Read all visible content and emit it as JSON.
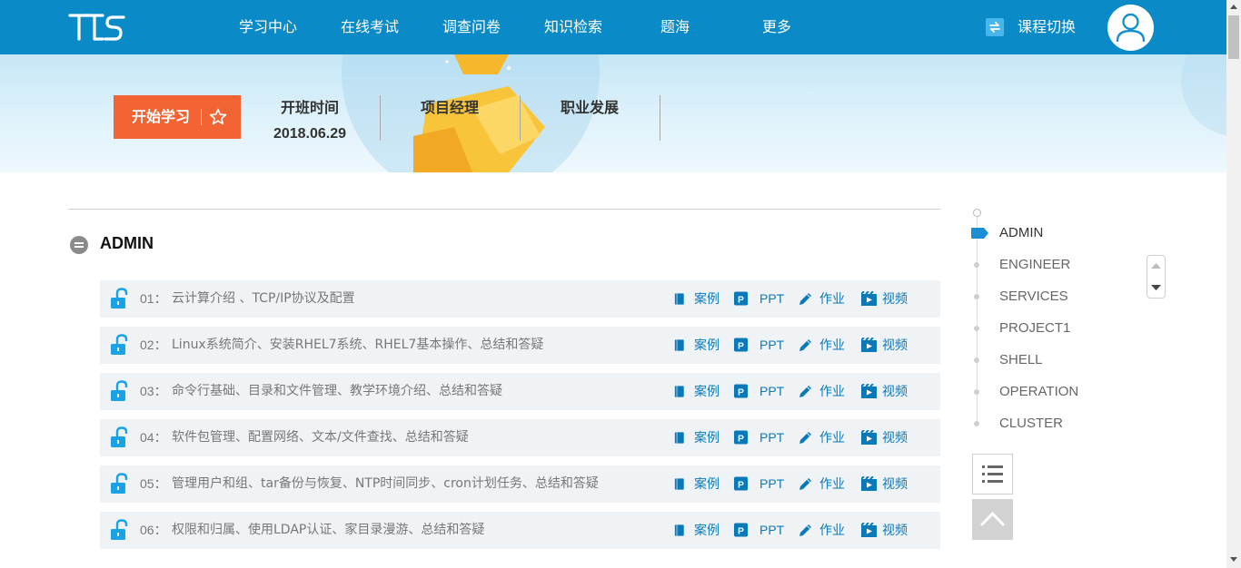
{
  "header": {
    "logo_text": "TTS",
    "nav": [
      "学习中心",
      "在线考试",
      "调查问卷",
      "知识检索",
      "题海",
      "更多"
    ],
    "course_switch_label": "课程切换"
  },
  "banner": {
    "start_label": "开始学习",
    "info": [
      {
        "title": "开班时间",
        "value": "2018.06.29"
      },
      {
        "title": "项目经理",
        "value": ""
      },
      {
        "title": "职业发展",
        "value": ""
      }
    ]
  },
  "section": {
    "title": "ADMIN",
    "lessons": [
      {
        "num": "01：",
        "title": "云计算介绍 、TCP/IP协议及配置"
      },
      {
        "num": "02：",
        "title": "Linux系统简介、安装RHEL7系统、RHEL7基本操作、总结和答疑"
      },
      {
        "num": "03：",
        "title": "命令行基础、目录和文件管理、教学环境介绍、总结和答疑"
      },
      {
        "num": "04：",
        "title": "软件包管理、配置网络、文本/文件查找、总结和答疑"
      },
      {
        "num": "05：",
        "title": "管理用户和组、tar备份与恢复、NTP时间同步、cron计划任务、总结和答疑"
      },
      {
        "num": "06：",
        "title": "权限和归属、使用LDAP认证、家目录漫游、总结和答疑"
      }
    ],
    "actions": {
      "case": "案例",
      "ppt": "PPT",
      "homework": "作业",
      "video": "视频"
    }
  },
  "outline": {
    "items": [
      "ADMIN",
      "ENGINEER",
      "SERVICES",
      "PROJECT1",
      "SHELL",
      "OPERATION",
      "CLUSTER"
    ],
    "active": "ADMIN"
  },
  "colors": {
    "brand_blue": "#0a8ac6",
    "start_orange": "#f26433",
    "link_blue": "#0a79b8",
    "unlock_blue": "#1aa2e6"
  },
  "icons": [
    "switch-icon",
    "user-icon",
    "star-icon",
    "collapse-icon",
    "unlock-icon",
    "book-icon",
    "ppt-icon",
    "pencil-icon",
    "video-icon",
    "list-icon",
    "chevron-up-icon"
  ]
}
